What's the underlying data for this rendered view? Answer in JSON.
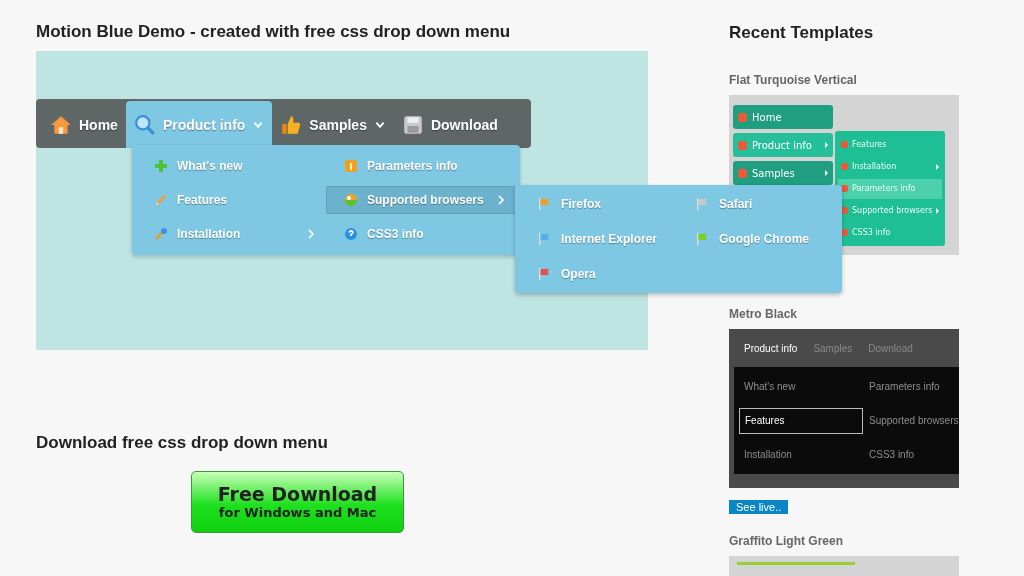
{
  "page_title": "Motion Blue Demo - created with free css drop down menu",
  "demo_menu": {
    "items": [
      {
        "label": "Home",
        "has_submenu": false,
        "selected": false
      },
      {
        "label": "Product info",
        "has_submenu": true,
        "selected": true
      },
      {
        "label": "Samples",
        "has_submenu": true,
        "selected": false
      },
      {
        "label": "Download",
        "has_submenu": false,
        "selected": false
      }
    ],
    "dropdown": [
      {
        "label": "What's new",
        "has_submenu": false,
        "selected": false
      },
      {
        "label": "Parameters info",
        "has_submenu": false,
        "selected": false
      },
      {
        "label": "Features",
        "has_submenu": false,
        "selected": false
      },
      {
        "label": "Supported browsers",
        "has_submenu": true,
        "selected": true
      },
      {
        "label": "Installation",
        "has_submenu": true,
        "selected": false
      },
      {
        "label": "CSS3 info",
        "has_submenu": false,
        "selected": false
      }
    ],
    "browsers": [
      {
        "label": "Firefox",
        "color": "#f0a020"
      },
      {
        "label": "Safari",
        "color": "#c8c8c8"
      },
      {
        "label": "Internet Explorer",
        "color": "#5aaee8"
      },
      {
        "label": "Google Chrome",
        "color": "#7cd020"
      },
      {
        "label": "Opera",
        "color": "#e85050"
      }
    ]
  },
  "download": {
    "heading": "Download free css drop down menu",
    "button_title": "Free Download",
    "button_subtitle": "for Windows and Mac"
  },
  "recent_templates": {
    "title": "Recent Templates",
    "templates": [
      {
        "name": "Flat Turquoise Vertical",
        "kind": "flat",
        "menu": [
          {
            "label": "Home",
            "has_submenu": false,
            "selected": false
          },
          {
            "label": "Product info",
            "has_submenu": true,
            "selected": true
          },
          {
            "label": "Samples",
            "has_submenu": true,
            "selected": false
          }
        ],
        "submenu": [
          {
            "label": "Features",
            "has_submenu": false,
            "selected": false
          },
          {
            "label": "Installation",
            "has_submenu": true,
            "selected": false
          },
          {
            "label": "Parameters info",
            "has_submenu": false,
            "selected": true
          },
          {
            "label": "Supported browsers",
            "has_submenu": true,
            "selected": false
          },
          {
            "label": "CSS3 info",
            "has_submenu": false,
            "selected": false
          }
        ]
      },
      {
        "name": "Metro Black",
        "kind": "metro",
        "tabs": [
          {
            "label": "Product info",
            "selected": true
          },
          {
            "label": "Samples",
            "selected": false
          },
          {
            "label": "Download",
            "selected": false
          }
        ],
        "items": [
          {
            "label": "What's new",
            "selected": false
          },
          {
            "label": "Parameters info",
            "selected": false
          },
          {
            "label": "Features",
            "selected": true
          },
          {
            "label": "Supported browsers",
            "selected": false
          },
          {
            "label": "Installation",
            "selected": false
          },
          {
            "label": "CSS3 info",
            "selected": false
          }
        ],
        "link": "See live.."
      },
      {
        "name": "Graffito Light Green",
        "kind": "graffito"
      }
    ]
  }
}
